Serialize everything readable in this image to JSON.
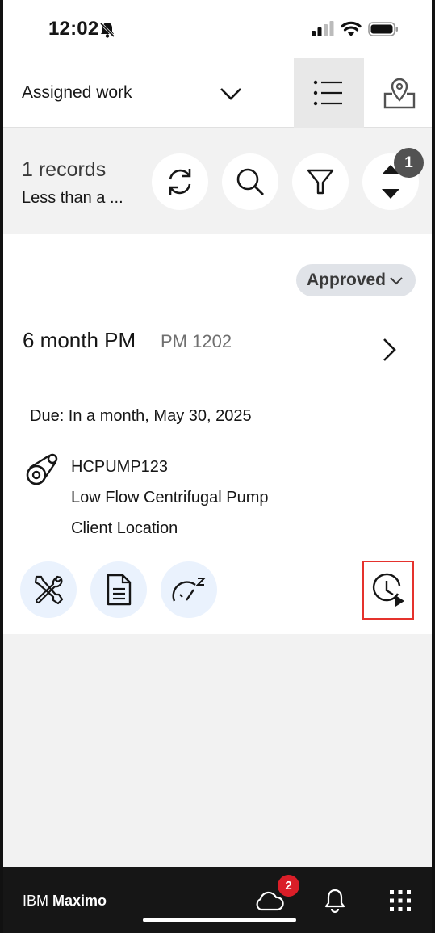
{
  "status_bar": {
    "time": "12:02",
    "icons": [
      "bell-slash-icon",
      "signal-icon",
      "wifi-icon",
      "battery-icon"
    ]
  },
  "header": {
    "title": "Assigned work",
    "icons": [
      "chevron-down-icon",
      "list-view-icon",
      "map-pin-icon"
    ]
  },
  "toolbar": {
    "count_label": "1 records",
    "sync_label": "Less than a ...",
    "buttons": [
      "refresh-icon",
      "search-icon",
      "filter-icon",
      "sort-icon"
    ],
    "sort_badge": "1"
  },
  "work_order": {
    "status": "Approved",
    "title": "6 month PM",
    "number": "PM 1202",
    "due": "Due: In a month, May 30, 2025",
    "asset_id": "HCPUMP123",
    "asset_desc": "Low Flow Centrifugal Pump",
    "location": "Client Location",
    "actions": [
      "tools-icon",
      "document-icon",
      "meter-icon",
      "timer-play-icon"
    ]
  },
  "bottom_bar": {
    "brand_prefix": "IBM",
    "brand_name": "Maximo",
    "cloud_badge": "2",
    "icons": [
      "cloud-icon",
      "notification-bell-icon",
      "app-grid-icon"
    ]
  },
  "colors": {
    "accent_button_bg": "#eaf2fd",
    "badge_red": "#da1e28",
    "highlight_red": "#e5322d",
    "bottom_bar": "#161616"
  }
}
